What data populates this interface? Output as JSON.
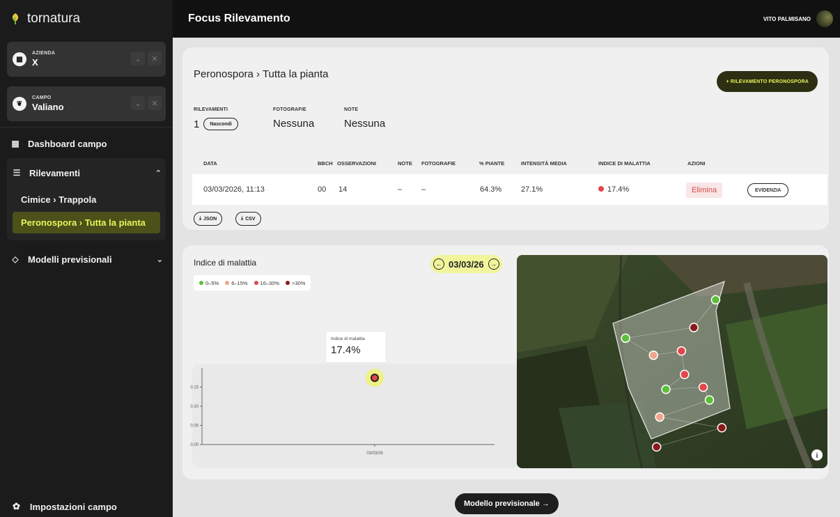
{
  "sidebar": {
    "brand": "tornatura",
    "azienda": {
      "label": "AZIENDA",
      "value": "X"
    },
    "campo": {
      "label": "CAMPO",
      "value": "Valiano"
    },
    "nav": {
      "dashboard": "Dashboard campo",
      "rilevamenti": "Rilevamenti",
      "sub": [
        "Cimice › Trappola",
        "Peronospora › Tutta la pianta"
      ],
      "modelli": "Modelli previsionali",
      "settings": "Impostazioni campo"
    }
  },
  "topbar": {
    "title": "Focus Rilevamento",
    "user": "VITO PALMISANO"
  },
  "summary": {
    "title": "Peronospora › Tutta la pianta",
    "add_button": "+ RILEVAMENTO PERONOSPORA",
    "rilevamenti_label": "RILEVAMENTI",
    "rilevamenti_value": "1",
    "hide_button": "Nascondi",
    "fotografie_label": "FOTOGRAFIE",
    "fotografie_value": "Nessuna",
    "note_label": "NOTE",
    "note_value": "Nessuna"
  },
  "table": {
    "headers": [
      "DATA",
      "BBCH",
      "OSSERVAZIONI",
      "NOTE",
      "FOTOGRAFIE",
      "% PIANTE",
      "INTENSITÀ MEDIA",
      "INDICE DI MALATTIA",
      "AZIONI"
    ],
    "rows": [
      {
        "data": "03/03/2026, 11:13",
        "bbch": "00",
        "osservazioni": "14",
        "note": "–",
        "fotografie": "–",
        "piante": "64.3%",
        "intensita": "27.1%",
        "indice": "17.4%",
        "indice_color": "#e2474b",
        "delete": "Elimina",
        "highlight": "EVIDENZIA"
      }
    ],
    "download_json": "JSON",
    "download_csv": "CSV"
  },
  "chart_panel": {
    "title": "Indice di malattia",
    "date": "03/03/26",
    "legend": [
      {
        "label": "0–5%",
        "color": "#5cbf3a"
      },
      {
        "label": "6–15%",
        "color": "#f0a58c"
      },
      {
        "label": "16–30%",
        "color": "#e2474b"
      },
      {
        "label": ">30%",
        "color": "#8b1a1a"
      }
    ],
    "tooltip_label": "Indice di malattia",
    "tooltip_value": "17.4%"
  },
  "chart_data": {
    "type": "scatter",
    "x": [
      "03/03/26"
    ],
    "y": [
      0.174
    ],
    "yticks": [
      "0.00",
      "0.05",
      "0.10",
      "0.15"
    ],
    "ylim": [
      0,
      0.2
    ],
    "title": "Indice di malattia",
    "xlabel": "",
    "ylabel": ""
  },
  "map": {
    "points": [
      {
        "x": 0.64,
        "y": 0.21,
        "color": "#5cbf3a"
      },
      {
        "x": 0.57,
        "y": 0.34,
        "color": "#8b1a1a"
      },
      {
        "x": 0.35,
        "y": 0.39,
        "color": "#5cbf3a"
      },
      {
        "x": 0.44,
        "y": 0.47,
        "color": "#f0a58c"
      },
      {
        "x": 0.53,
        "y": 0.45,
        "color": "#e2474b"
      },
      {
        "x": 0.54,
        "y": 0.56,
        "color": "#e2474b"
      },
      {
        "x": 0.48,
        "y": 0.63,
        "color": "#5cbf3a"
      },
      {
        "x": 0.6,
        "y": 0.62,
        "color": "#e2474b"
      },
      {
        "x": 0.62,
        "y": 0.68,
        "color": "#5cbf3a"
      },
      {
        "x": 0.46,
        "y": 0.76,
        "color": "#f0a58c"
      },
      {
        "x": 0.66,
        "y": 0.81,
        "color": "#8b1a1a"
      },
      {
        "x": 0.45,
        "y": 0.9,
        "color": "#8b1a1a"
      }
    ]
  },
  "footer_button": "Modello previsionale →"
}
